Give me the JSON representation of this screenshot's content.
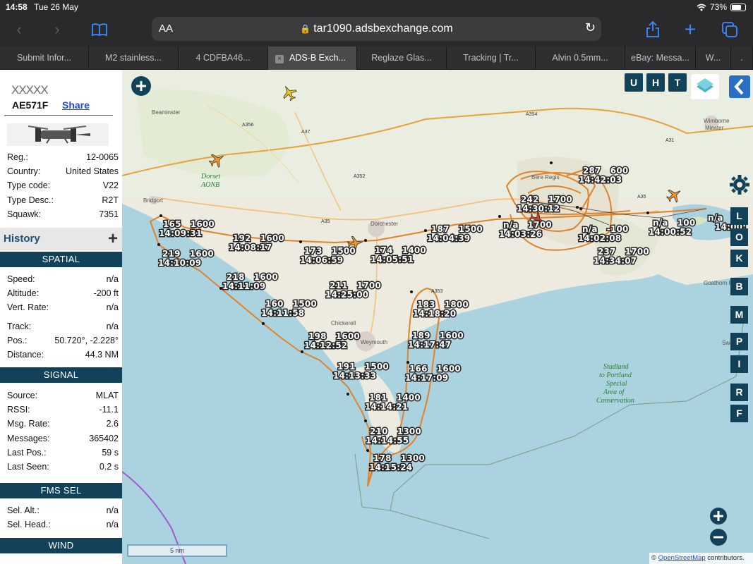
{
  "status": {
    "time": "14:58",
    "date": "Tue 26 May",
    "battery": "73%"
  },
  "browser": {
    "url": "tar1090.adsbexchange.com",
    "text_size": "AA",
    "tabs": [
      {
        "label": "Submit Infor..."
      },
      {
        "label": "M2 stainless..."
      },
      {
        "label": "4 CDFBA46..."
      },
      {
        "label": "ADS-B Exch...",
        "active": true
      },
      {
        "label": "Reglaze Glas..."
      },
      {
        "label": "Tracking | Tr..."
      },
      {
        "label": "Alvin 0.5mm..."
      },
      {
        "label": "eBay: Messa..."
      },
      {
        "label": "W..."
      },
      {
        "label": "."
      }
    ]
  },
  "aircraft": {
    "callsign": "XXXXX",
    "hex": "AE571F",
    "share_label": "Share",
    "details": [
      {
        "k": "Reg.:",
        "v": "12-0065"
      },
      {
        "k": "Country:",
        "v": "United States"
      },
      {
        "k": "Type code:",
        "v": "V22"
      },
      {
        "k": "Type Desc.:",
        "v": "R2T"
      },
      {
        "k": "Squawk:",
        "v": "7351"
      }
    ]
  },
  "history_label": "History",
  "spatial": {
    "title": "SPATIAL",
    "rows": [
      {
        "k": "Speed:",
        "v": "n/a"
      },
      {
        "k": "Altitude:",
        "v": "-200 ft"
      },
      {
        "k": "Vert. Rate:",
        "v": "n/a"
      },
      {
        "k": "Track:",
        "v": "n/a"
      },
      {
        "k": "Pos.:",
        "v": "50.720°, -2.228°"
      },
      {
        "k": "Distance:",
        "v": "44.3 NM"
      }
    ]
  },
  "signal": {
    "title": "SIGNAL",
    "rows": [
      {
        "k": "Source:",
        "v": "MLAT"
      },
      {
        "k": "RSSI:",
        "v": "-11.1"
      },
      {
        "k": "Msg. Rate:",
        "v": "2.6"
      },
      {
        "k": "Messages:",
        "v": "365402"
      },
      {
        "k": "Last Pos.:",
        "v": "59 s"
      },
      {
        "k": "Last Seen:",
        "v": "0.2 s"
      }
    ]
  },
  "fms": {
    "title": "FMS SEL",
    "rows": [
      {
        "k": "Sel. Alt.:",
        "v": "n/a"
      },
      {
        "k": "Sel. Head.:",
        "v": "n/a"
      }
    ]
  },
  "wind": {
    "title": "WIND"
  },
  "map": {
    "top_buttons": [
      "U",
      "H",
      "T"
    ],
    "side_buttons": [
      "L",
      "O",
      "K",
      "B",
      "M",
      "P",
      "I",
      "R",
      "F"
    ],
    "scale": "5 nm",
    "attribution_prefix": "©",
    "attribution_link": "OpenStreetMap",
    "attribution_suffix": "contributors.",
    "places": [
      "Beaminster",
      "Bridport",
      "Dorset",
      "AONB",
      "Dorchester",
      "Bere Regis",
      "Wimborne",
      "Minster",
      "Chickerell",
      "Weymouth",
      "Goathorn Point",
      "Swanage"
    ],
    "roads": [
      "A356",
      "A37",
      "A354",
      "A352",
      "A35",
      "A353",
      "A31",
      "A35"
    ],
    "conservation": [
      "Studland",
      "to Portland",
      "Special",
      "Area of",
      "Conservation"
    ],
    "track_labels": [
      {
        "top": "287 600",
        "bottom": "14:42:03"
      },
      {
        "top": "242 1700",
        "bottom": "14:30:12"
      },
      {
        "top": "n/a 1700",
        "bottom": "14:03:26"
      },
      {
        "top": "n/a -100",
        "bottom": "14:02:08"
      },
      {
        "top": "n/a 100",
        "bottom": "14:00:52"
      },
      {
        "top": "237 1700",
        "bottom": "14:34:07"
      },
      {
        "top": "187 1500",
        "bottom": "14:04:39"
      },
      {
        "top": "174 1400",
        "bottom": "14:05:51"
      },
      {
        "top": "173 1500",
        "bottom": "14:06:59"
      },
      {
        "top": "192 1600",
        "bottom": "14:08:17"
      },
      {
        "top": "165 1600",
        "bottom": "14:09:31"
      },
      {
        "top": "219 1600",
        "bottom": "14:10:09"
      },
      {
        "top": "218 1600",
        "bottom": "14:11:09"
      },
      {
        "top": "160 1500",
        "bottom": "14:11:58"
      },
      {
        "top": "198 1600",
        "bottom": "14:12:52"
      },
      {
        "top": "191 1500",
        "bottom": "14:13:33"
      },
      {
        "top": "181 1400",
        "bottom": "14:14:21"
      },
      {
        "top": "210 1300",
        "bottom": "14:14:55"
      },
      {
        "top": "178 1300",
        "bottom": "14:15:24"
      },
      {
        "top": "166 1600",
        "bottom": "14:17:09"
      },
      {
        "top": "189 1600",
        "bottom": "14:17:47"
      },
      {
        "top": "183 1800",
        "bottom": "14:18:20"
      },
      {
        "top": "211 1700",
        "bottom": "14:25:00"
      }
    ],
    "edge_labels": {
      "na": "n/a",
      "time": "14:00:"
    },
    "colors": {
      "track": "#e0832c",
      "panel": "#12425a",
      "sea": "#aad3df",
      "land": "#edeadf",
      "aircraft_selected": "#e03a1e"
    }
  }
}
